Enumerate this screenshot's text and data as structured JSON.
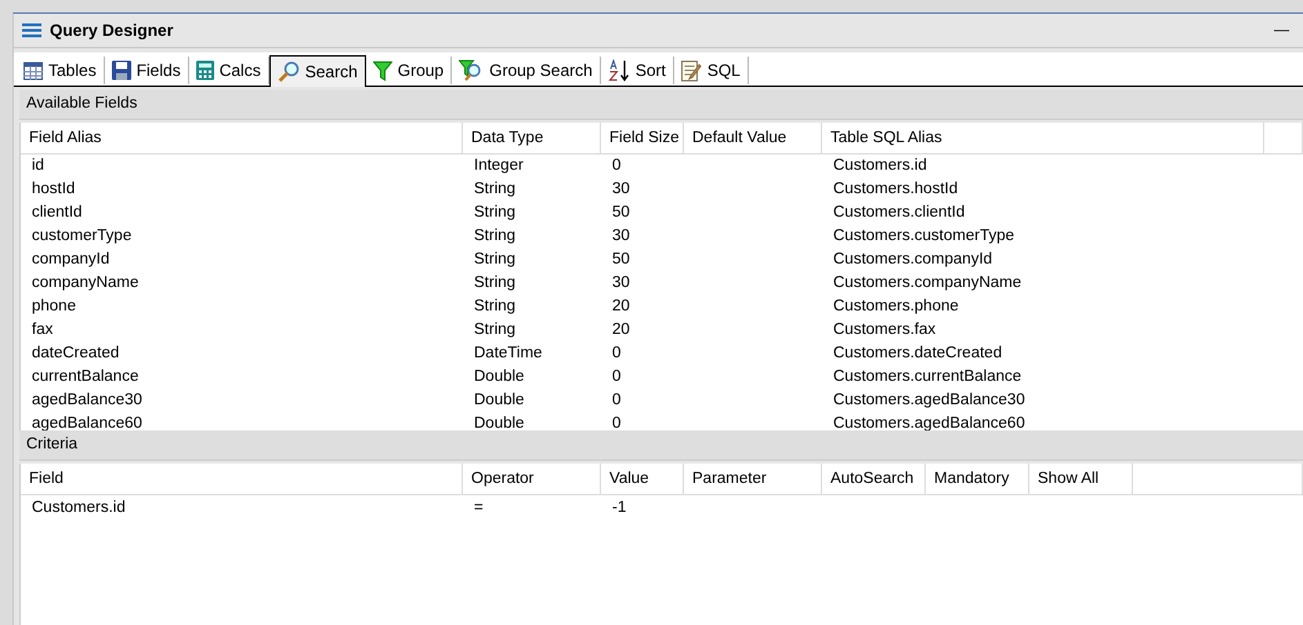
{
  "window": {
    "title": "Query Designer",
    "minimize": "—"
  },
  "tabs": [
    {
      "label": "Tables",
      "kind": "table",
      "selected": false
    },
    {
      "label": "Fields",
      "kind": "disk",
      "selected": false
    },
    {
      "label": "Calcs",
      "kind": "calculator",
      "selected": false
    },
    {
      "label": "Search",
      "kind": "magnifier",
      "selected": true
    },
    {
      "label": "Group",
      "kind": "funnel",
      "selected": false
    },
    {
      "label": "Group Search",
      "kind": "funnel-magnifier",
      "selected": false
    },
    {
      "label": "Sort",
      "kind": "sort",
      "selected": false
    },
    {
      "label": "SQL",
      "kind": "notepad",
      "selected": false
    }
  ],
  "available_fields": {
    "title": "Available Fields",
    "columns": [
      "Field Alias",
      "Data Type",
      "Field Size",
      "Default Value",
      "Table SQL Alias"
    ],
    "rows": [
      [
        "id",
        "Integer",
        "0",
        "",
        "Customers.id"
      ],
      [
        "hostId",
        "String",
        "30",
        "",
        "Customers.hostId"
      ],
      [
        "clientId",
        "String",
        "50",
        "",
        "Customers.clientId"
      ],
      [
        "customerType",
        "String",
        "30",
        "",
        "Customers.customerType"
      ],
      [
        "companyId",
        "String",
        "50",
        "",
        "Customers.companyId"
      ],
      [
        "companyName",
        "String",
        "30",
        "",
        "Customers.companyName"
      ],
      [
        "phone",
        "String",
        "20",
        "",
        "Customers.phone"
      ],
      [
        "fax",
        "String",
        "20",
        "",
        "Customers.fax"
      ],
      [
        "dateCreated",
        "DateTime",
        "0",
        "",
        "Customers.dateCreated"
      ],
      [
        "currentBalance",
        "Double",
        "0",
        "",
        "Customers.currentBalance"
      ],
      [
        "agedBalance30",
        "Double",
        "0",
        "",
        "Customers.agedBalance30"
      ],
      [
        "agedBalance60",
        "Double",
        "0",
        "",
        "Customers.agedBalance60"
      ]
    ]
  },
  "criteria": {
    "title": "Criteria",
    "columns": [
      "Field",
      "Operator",
      "Value",
      "Parameter",
      "AutoSearch",
      "Mandatory",
      "Show All"
    ],
    "rows": [
      [
        "Customers.id",
        "=",
        "-1",
        "",
        "",
        "",
        ""
      ]
    ]
  }
}
